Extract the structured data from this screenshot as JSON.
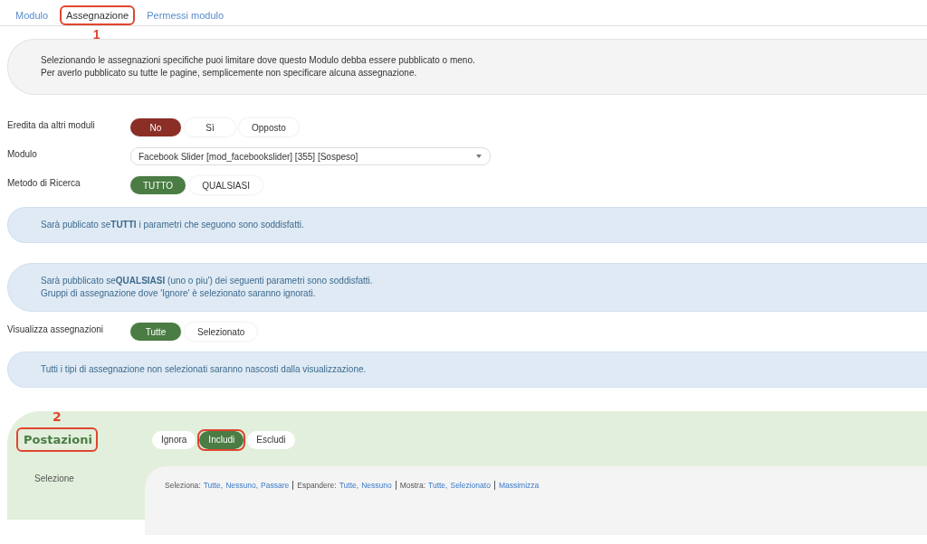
{
  "tabs": [
    {
      "label": "Modulo",
      "selected": false,
      "annotated": false
    },
    {
      "label": "Assegnazione",
      "selected": true,
      "annotated": true,
      "marker": "1"
    },
    {
      "label": "Permessi modulo",
      "selected": false,
      "annotated": false
    }
  ],
  "intro": {
    "lines": [
      "Selezionando le assegnazioni specifiche puoi limitare dove questo Modulo debba essere pubblicato o meno.",
      "Per averlo pubblicato su tutte le pagine, semplicemente non specificare alcuna assegnazione."
    ]
  },
  "fields": [
    {
      "kind": "toggle",
      "label": "Eredita da altri moduli",
      "color": "#8b2e26",
      "options": [
        {
          "label": "No",
          "selected": true
        },
        {
          "label": "Sì",
          "selected": false
        },
        {
          "label": "Opposto",
          "selected": false
        }
      ]
    },
    {
      "kind": "select",
      "label": "Modulo",
      "value": "Facebook Slider [mod_facebookslider] [355] [Sospeso]"
    },
    {
      "kind": "toggle",
      "label": "Metodo di Ricerca",
      "color": "#4a7c43",
      "options": [
        {
          "label": "TUTTO",
          "selected": true
        },
        {
          "label": "QUALSIASI",
          "selected": false
        }
      ]
    },
    {
      "kind": "notice",
      "lines": [
        "Sarà publicato se**TUTTI** i parametri che seguono sono soddisfatti."
      ]
    },
    {
      "kind": "notice",
      "lines": [
        "Sarà pubblicato se**QUALSIASI** (uno o piu') dei seguenti parametri sono soddisfatti.",
        "Gruppi di assegnazione dove 'Ignore' è selezionato saranno ignorati."
      ]
    },
    {
      "kind": "toggle",
      "label": "Visualizza assegnazioni",
      "color": "#4a7c43",
      "options": [
        {
          "label": "Tutte",
          "selected": true
        },
        {
          "label": "Selezionato",
          "selected": false
        }
      ]
    },
    {
      "kind": "notice",
      "lines": [
        "Tutti i tipi di assegnazione non selezionati saranno nascosti dalla visualizzazione."
      ]
    }
  ],
  "panel": {
    "title": "Postazioni",
    "marker": "2",
    "options": [
      {
        "label": "Ignora",
        "selected": false,
        "annotated": false
      },
      {
        "label": "Includi",
        "selected": true,
        "annotated": true
      },
      {
        "label": "Escludi",
        "selected": false,
        "annotated": false
      }
    ],
    "selection_label": "Selezione",
    "link_groups": [
      {
        "label": "Seleziona:",
        "links": [
          "Tutte,",
          "Nessuno,",
          "Passare"
        ]
      },
      {
        "label": "Espandere:",
        "links": [
          "Tutte,",
          "Nessuno"
        ]
      },
      {
        "label": "Mostra:",
        "links": [
          "Tutte,",
          "Selezionato"
        ]
      },
      {
        "links": [
          "Massimizza"
        ]
      }
    ]
  }
}
